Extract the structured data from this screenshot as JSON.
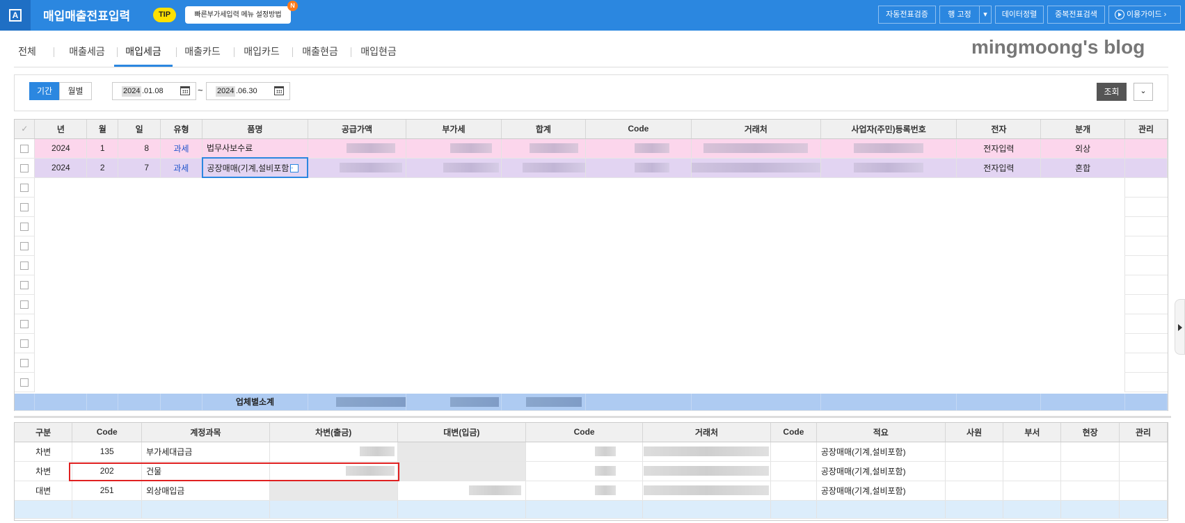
{
  "app": {
    "title": "매입매출전표입력",
    "tip_badge": "TIP",
    "tip_text": "빠른부가세입력 메뉴 설정방법",
    "tip_new": "N"
  },
  "toolbar": {
    "auto_verify": "자동전표검증",
    "row_fix": "행 고정",
    "row_fix_arrow": "▾",
    "data_sort": "데이터정렬",
    "dup_search": "중복전표검색",
    "guide": "이용가이드",
    "guide_arrow": "›"
  },
  "brand": "mingmoong's blog",
  "tabs": [
    "전체",
    "매출세금",
    "매입세금",
    "매출카드",
    "매입카드",
    "매출현금",
    "매입현금"
  ],
  "active_tab": "매입세금",
  "filter": {
    "period_label": "기간",
    "monthly_label": "월별",
    "from_year": "2024",
    "from_md": ".01.08",
    "to_year": "2024",
    "to_md": ".06.30",
    "tilde": "~",
    "search_label": "조회",
    "toggle_label": "⌄"
  },
  "grid1": {
    "headers": [
      "년",
      "월",
      "일",
      "유형",
      "품명",
      "공급가액",
      "부가세",
      "합계",
      "Code",
      "거래처",
      "사업자(주민)등록번호",
      "전자",
      "분개",
      "관리"
    ],
    "rows": [
      {
        "year": "2024",
        "month": "1",
        "day": "8",
        "type": "과세",
        "item": "법무사보수료",
        "ejeon": "전자입력",
        "bungae": "외상"
      },
      {
        "year": "2024",
        "month": "2",
        "day": "7",
        "type": "과세",
        "item": "공장매매(기계,설비포함",
        "ejeon": "전자입력",
        "bungae": "혼합"
      }
    ],
    "subtotal_label": "업체별소계"
  },
  "grid2": {
    "headers": [
      "구분",
      "Code",
      "계정과목",
      "차변(출금)",
      "대변(입금)",
      "Code",
      "거래처",
      "Code",
      "적요",
      "사원",
      "부서",
      "현장",
      "관리"
    ],
    "rows": [
      {
        "gubun": "차변",
        "code": "135",
        "account": "부가세대급금",
        "memo": "공장매매(기계,설비포함)"
      },
      {
        "gubun": "차변",
        "code": "202",
        "account": "건물",
        "memo": "공장매매(기계,설비포함)"
      },
      {
        "gubun": "대변",
        "code": "251",
        "account": "외상매입금",
        "memo": "공장매매(기계,설비포함)"
      }
    ]
  },
  "colors": {
    "topbar": "#2b87e0",
    "row1": "#fcd6ec",
    "row2": "#e2d4f2",
    "subtotal": "#aecbf2",
    "highlight": "#e02020"
  }
}
